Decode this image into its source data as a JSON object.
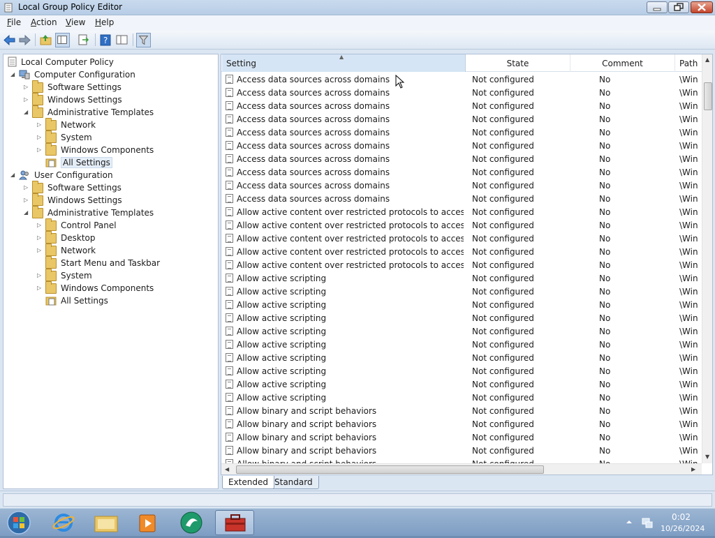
{
  "window": {
    "title": "Local Group Policy Editor"
  },
  "menu": [
    {
      "label": "File",
      "key": "F",
      "rest": "ile"
    },
    {
      "label": "Action",
      "key": "A",
      "rest": "ction"
    },
    {
      "label": "View",
      "key": "V",
      "rest": "iew"
    },
    {
      "label": "Help",
      "key": "H",
      "rest": "elp"
    }
  ],
  "tree": {
    "root": "Local Computer Policy",
    "computer_config": "Computer Configuration",
    "cc_software": "Software Settings",
    "cc_windows": "Windows Settings",
    "cc_admin": "Administrative Templates",
    "cc_network": "Network",
    "cc_system": "System",
    "cc_wincomp": "Windows Components",
    "cc_all": "All Settings",
    "user_config": "User Configuration",
    "uc_software": "Software Settings",
    "uc_windows": "Windows Settings",
    "uc_admin": "Administrative Templates",
    "uc_control": "Control Panel",
    "uc_desktop": "Desktop",
    "uc_network": "Network",
    "uc_startmenu": "Start Menu and Taskbar",
    "uc_system": "System",
    "uc_wincomp": "Windows Components",
    "uc_all": "All Settings"
  },
  "list": {
    "headers": {
      "setting": "Setting",
      "state": "State",
      "comment": "Comment",
      "path": "Path"
    },
    "rows": [
      {
        "setting": "Access data sources across domains",
        "state": "Not configured",
        "comment": "No",
        "path": "\\Win"
      },
      {
        "setting": "Access data sources across domains",
        "state": "Not configured",
        "comment": "No",
        "path": "\\Win"
      },
      {
        "setting": "Access data sources across domains",
        "state": "Not configured",
        "comment": "No",
        "path": "\\Win"
      },
      {
        "setting": "Access data sources across domains",
        "state": "Not configured",
        "comment": "No",
        "path": "\\Win"
      },
      {
        "setting": "Access data sources across domains",
        "state": "Not configured",
        "comment": "No",
        "path": "\\Win"
      },
      {
        "setting": "Access data sources across domains",
        "state": "Not configured",
        "comment": "No",
        "path": "\\Win"
      },
      {
        "setting": "Access data sources across domains",
        "state": "Not configured",
        "comment": "No",
        "path": "\\Win"
      },
      {
        "setting": "Access data sources across domains",
        "state": "Not configured",
        "comment": "No",
        "path": "\\Win"
      },
      {
        "setting": "Access data sources across domains",
        "state": "Not configured",
        "comment": "No",
        "path": "\\Win"
      },
      {
        "setting": "Access data sources across domains",
        "state": "Not configured",
        "comment": "No",
        "path": "\\Win"
      },
      {
        "setting": "Allow active content over restricted protocols to access my ...",
        "state": "Not configured",
        "comment": "No",
        "path": "\\Win"
      },
      {
        "setting": "Allow active content over restricted protocols to access my ...",
        "state": "Not configured",
        "comment": "No",
        "path": "\\Win"
      },
      {
        "setting": "Allow active content over restricted protocols to access my ...",
        "state": "Not configured",
        "comment": "No",
        "path": "\\Win"
      },
      {
        "setting": "Allow active content over restricted protocols to access my ...",
        "state": "Not configured",
        "comment": "No",
        "path": "\\Win"
      },
      {
        "setting": "Allow active content over restricted protocols to access my ...",
        "state": "Not configured",
        "comment": "No",
        "path": "\\Win"
      },
      {
        "setting": "Allow active scripting",
        "state": "Not configured",
        "comment": "No",
        "path": "\\Win"
      },
      {
        "setting": "Allow active scripting",
        "state": "Not configured",
        "comment": "No",
        "path": "\\Win"
      },
      {
        "setting": "Allow active scripting",
        "state": "Not configured",
        "comment": "No",
        "path": "\\Win"
      },
      {
        "setting": "Allow active scripting",
        "state": "Not configured",
        "comment": "No",
        "path": "\\Win"
      },
      {
        "setting": "Allow active scripting",
        "state": "Not configured",
        "comment": "No",
        "path": "\\Win"
      },
      {
        "setting": "Allow active scripting",
        "state": "Not configured",
        "comment": "No",
        "path": "\\Win"
      },
      {
        "setting": "Allow active scripting",
        "state": "Not configured",
        "comment": "No",
        "path": "\\Win"
      },
      {
        "setting": "Allow active scripting",
        "state": "Not configured",
        "comment": "No",
        "path": "\\Win"
      },
      {
        "setting": "Allow active scripting",
        "state": "Not configured",
        "comment": "No",
        "path": "\\Win"
      },
      {
        "setting": "Allow active scripting",
        "state": "Not configured",
        "comment": "No",
        "path": "\\Win"
      },
      {
        "setting": "Allow binary and script behaviors",
        "state": "Not configured",
        "comment": "No",
        "path": "\\Win"
      },
      {
        "setting": "Allow binary and script behaviors",
        "state": "Not configured",
        "comment": "No",
        "path": "\\Win"
      },
      {
        "setting": "Allow binary and script behaviors",
        "state": "Not configured",
        "comment": "No",
        "path": "\\Win"
      },
      {
        "setting": "Allow binary and script behaviors",
        "state": "Not configured",
        "comment": "No",
        "path": "\\Win"
      },
      {
        "setting": "Allow binary and script behaviors",
        "state": "Not configured",
        "comment": "No",
        "path": "\\Win"
      }
    ]
  },
  "tabs": {
    "extended": "Extended",
    "standard": "Standard"
  },
  "clock": {
    "time": "0:02",
    "date": "10/26/2024"
  }
}
